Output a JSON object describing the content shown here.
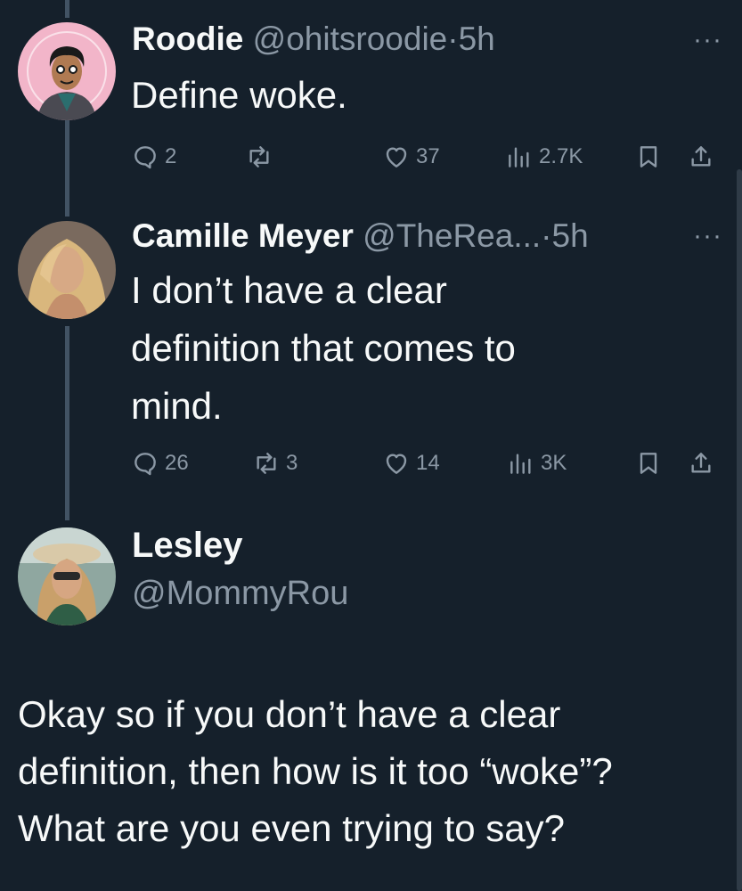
{
  "tweets": [
    {
      "name": "Roodie",
      "handle": "@ohitsroodie",
      "sep": "·",
      "time": "5h",
      "text": [
        "Define woke."
      ],
      "replies": "2",
      "retweets": "",
      "likes": "37",
      "views": "2.7K"
    },
    {
      "name": "Camille Meyer",
      "handle": "@TheRea...",
      "sep": "·",
      "time": "5h",
      "text": [
        "I don’t have a clear",
        "definition that comes to",
        "mind."
      ],
      "replies": "26",
      "retweets": "3",
      "likes": "14",
      "views": "3K"
    }
  ],
  "reply": {
    "name": "Lesley",
    "handle": "@MommyRou",
    "text": [
      "Okay so if you don’t have a clear",
      "definition, then how is it too “woke”?",
      "What are you even trying to say?"
    ]
  },
  "more_icon": "···",
  "colors": {
    "background": "#15202b",
    "muted": "#8b98a5",
    "text": "#f7f9f9",
    "thread_line": "#425364"
  }
}
